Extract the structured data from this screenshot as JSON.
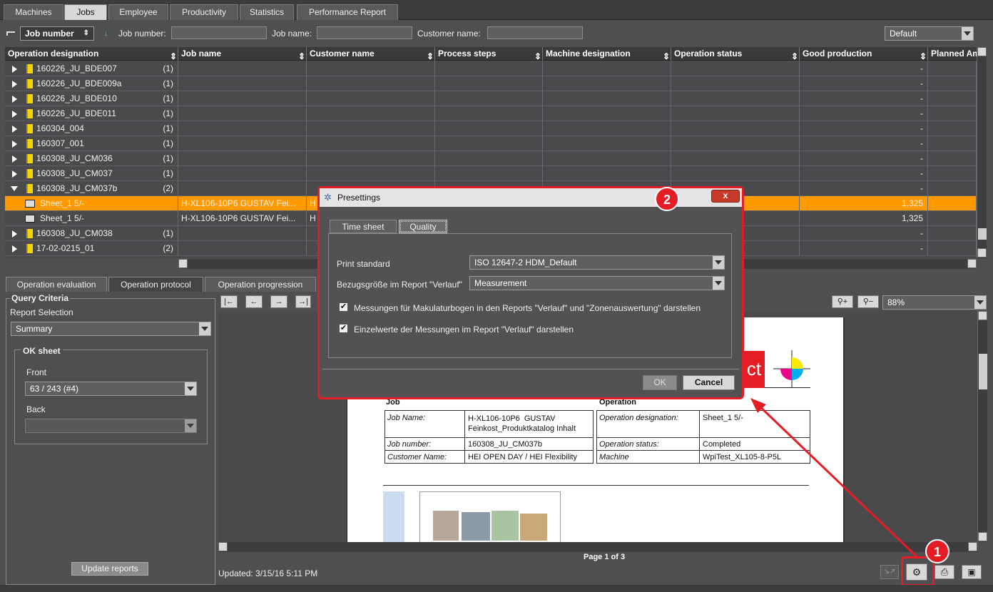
{
  "top_tabs": [
    "Machines",
    "Jobs",
    "Employee",
    "Productivity",
    "Statistics",
    "Performance Report"
  ],
  "filter": {
    "sort_combo": "Job number",
    "job_number_label": "Job number:",
    "job_name_label": "Job name:",
    "customer_name_label": "Customer name:",
    "preset": "Default"
  },
  "table": {
    "columns": [
      "Operation designation",
      "Job name",
      "Customer name",
      "Process steps",
      "Machine designation",
      "Operation status",
      "Good production",
      "Planned Am"
    ],
    "rows": [
      {
        "name": "160226_JU_BDE007",
        "count": "(1)",
        "good": "-"
      },
      {
        "name": "160226_JU_BDE009a",
        "count": "(1)",
        "good": "-"
      },
      {
        "name": "160226_JU_BDE010",
        "count": "(1)",
        "good": "-"
      },
      {
        "name": "160226_JU_BDE011",
        "count": "(1)",
        "good": "-"
      },
      {
        "name": "160304_004",
        "count": "(1)",
        "good": "-"
      },
      {
        "name": "160307_001",
        "count": "(1)",
        "good": "-"
      },
      {
        "name": "160308_JU_CM036",
        "count": "(1)",
        "good": "-"
      },
      {
        "name": "160308_JU_CM037",
        "count": "(1)",
        "good": "-"
      },
      {
        "name": "160308_JU_CM037b",
        "count": "(2)",
        "good": "-"
      },
      {
        "name": "Sheet_1  5/-",
        "job": "H-XL106-10P6  GUSTAV Fei...",
        "cust": "H",
        "good": "1,325"
      },
      {
        "name": "Sheet_1  5/-",
        "job": "H-XL106-10P6  GUSTAV Fei...",
        "cust": "H",
        "good": "1,325"
      },
      {
        "name": "160308_JU_CM038",
        "count": "(1)",
        "good": "-"
      },
      {
        "name": "17-02-0215_01",
        "count": "(2)",
        "good": "-"
      }
    ]
  },
  "bottom_tabs": [
    "Operation evaluation",
    "Operation protocol",
    "Operation progression"
  ],
  "query": {
    "title": "Query Criteria",
    "report_selection_label": "Report Selection",
    "report_selection": "Summary",
    "ok_sheet_title": "OK sheet",
    "front_label": "Front",
    "front_value": "63 / 243  (#4)",
    "back_label": "Back",
    "update_button": "Update reports"
  },
  "preview": {
    "zoom": "88%",
    "page_indicator": "Page 1 of 3",
    "updated": "Updated: 3/15/16 5:11 PM",
    "logo_fragment": "ct",
    "job_heading": "Job",
    "operation_heading": "Operation",
    "job_table": [
      [
        "Job Name:",
        "H-XL106-10P6  GUSTAV\nFeinkost_Produktkatalog Inhalt"
      ],
      [
        "Job number:",
        "160308_JU_CM037b"
      ],
      [
        "Customer Name:",
        "HEI OPEN DAY / HEI Flexibility"
      ]
    ],
    "op_table": [
      [
        "Operation designation:",
        "Sheet_1  5/-"
      ],
      [
        "Operation status:",
        "Completed"
      ],
      [
        "Machine",
        "WpiTest_XL105-8-P5L"
      ]
    ]
  },
  "dialog": {
    "title": "Presettings",
    "tabs": [
      "Time sheet",
      "Quality"
    ],
    "print_standard_label": "Print standard",
    "print_standard_value": "ISO 12647-2 HDM_Default",
    "reference_label": "Bezugsgröße im Report \"Verlauf\"",
    "reference_value": "Measurement",
    "check1": "Messungen für Makulaturbogen in den Reports \"Verlauf\" und \"Zonenauswertung\" darstellen",
    "check2": "Einzelwerte der Messungen im Report \"Verlauf\" darstellen",
    "ok": "OK",
    "cancel": "Cancel",
    "close": "x"
  },
  "badges": {
    "one": "1",
    "two": "2"
  },
  "colors": {
    "selection": "#ff9a00",
    "highlight": "#e41c24"
  }
}
